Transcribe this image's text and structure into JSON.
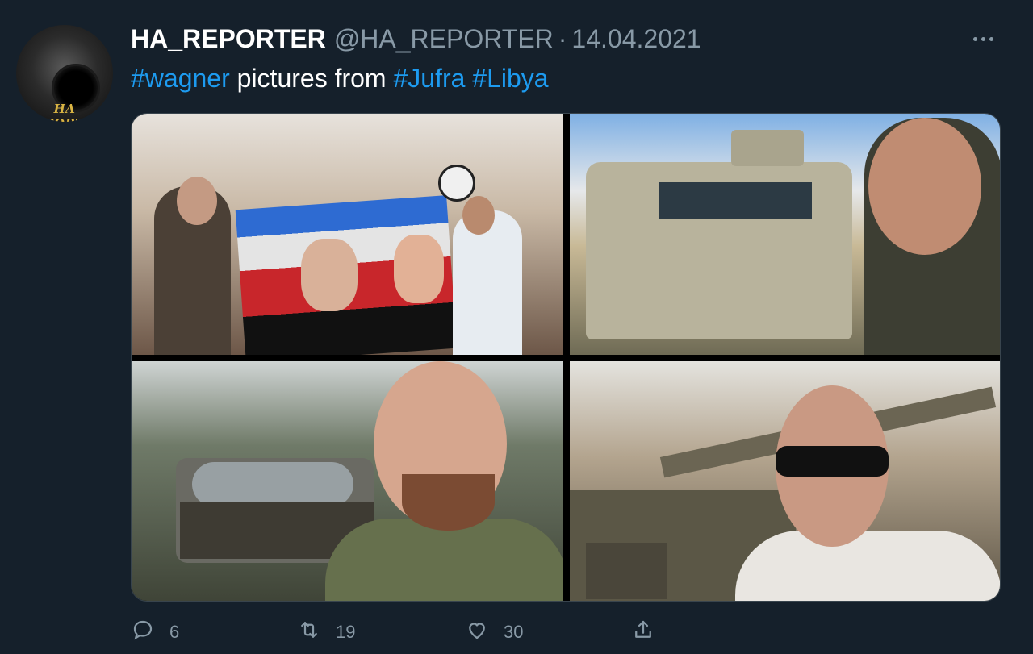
{
  "tweet": {
    "display_name": "HA_REPORTER",
    "handle": "@HA_REPORTER",
    "separator": "·",
    "date": "14.04.2021",
    "avatar_text": "HA REPORTER",
    "text_parts": [
      {
        "text": "#wagner",
        "hashtag": true
      },
      {
        "text": " pictures from ",
        "hashtag": false
      },
      {
        "text": "#Jufra",
        "hashtag": true
      },
      {
        "text": " ",
        "hashtag": false
      },
      {
        "text": "#Libya",
        "hashtag": true
      }
    ],
    "photos": [
      {
        "icon": "photo-shop-painting"
      },
      {
        "icon": "photo-armored-vehicle-selfie"
      },
      {
        "icon": "photo-tank-selfie"
      },
      {
        "icon": "photo-tank-sunglasses-selfie"
      }
    ]
  },
  "actions": {
    "reply_count": "6",
    "retweet_count": "19",
    "like_count": "30",
    "reply_icon": "comment-icon",
    "retweet_icon": "retweet-icon",
    "like_icon": "heart-icon",
    "share_icon": "share-icon"
  },
  "colors": {
    "background": "#15202b",
    "hashtag": "#1d9bf0",
    "secondary_text": "#8899a6"
  }
}
